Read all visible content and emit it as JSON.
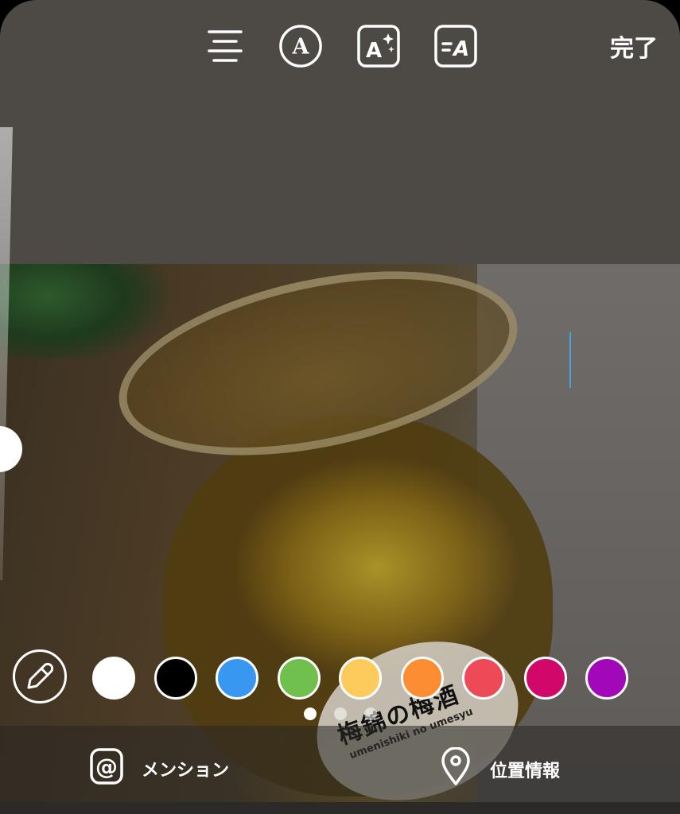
{
  "toolbar": {
    "align_icon": "align-center-icon",
    "font_icon": "font-style-icon",
    "effect_icon": "text-effect-icon",
    "background_icon": "text-background-icon",
    "done_label": "完了"
  },
  "photo": {
    "label_line_1": "梅錦の梅酒",
    "label_line_2": "umenishiki no umesyu"
  },
  "colors": {
    "picker_icon": "eyedropper-icon",
    "swatches": [
      "#ffffff",
      "#000000",
      "#3897f0",
      "#70c050",
      "#fdcb5c",
      "#fd8d32",
      "#ed4956",
      "#d10869",
      "#a307ba"
    ]
  },
  "pagination": {
    "count": 3,
    "active": 1
  },
  "bottom": {
    "mention_label": "メンション",
    "mention_icon": "at-sign-icon",
    "location_label": "位置情報",
    "location_icon": "location-pin-icon"
  }
}
